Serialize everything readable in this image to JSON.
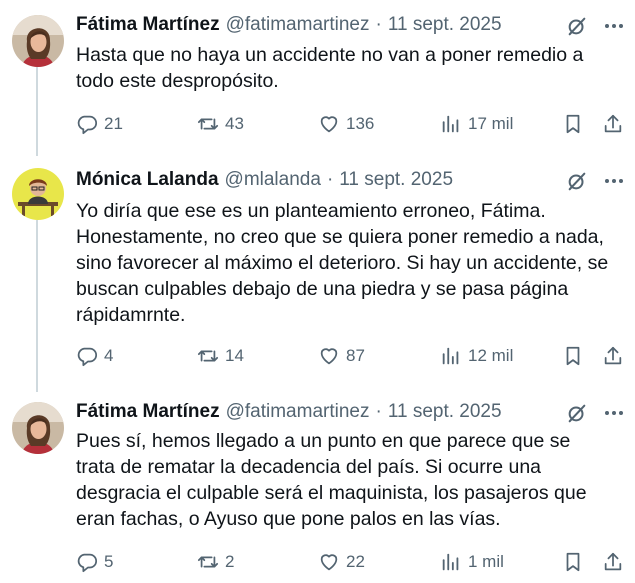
{
  "tweets": [
    {
      "author_name": "Fátima Martínez",
      "handle": "@fatimamartinez",
      "separator": "·",
      "date": "11 sept. 2025",
      "lines": [
        "Hasta que no haya un accidente no van a poner remedio a",
        "todo este despropósito."
      ],
      "replies": "21",
      "retweets": "43",
      "likes": "136",
      "views": "17 mil"
    },
    {
      "author_name": "Mónica Lalanda",
      "handle": "@mlalanda",
      "separator": "·",
      "date": "11 sept. 2025",
      "lines": [
        "Yo diría que ese es un planteamiento erroneo, Fátima.",
        "Honestamente, no creo que se quiera poner remedio a nada,",
        "sino favorecer al máximo el deterioro. Si hay un accidente, se",
        "buscan culpables debajo de una piedra y se pasa página",
        "rápidamrnte."
      ],
      "replies": "4",
      "retweets": "14",
      "likes": "87",
      "views": "12 mil"
    },
    {
      "author_name": "Fátima Martínez",
      "handle": "@fatimamartinez",
      "separator": "·",
      "date": "11 sept. 2025",
      "lines": [
        "Pues sí, hemos llegado a un punto en que parece que se",
        "trata de rematar la decadencia del país. Si ocurre una",
        "desgracia el culpable será el maquinista, los pasajeros que",
        "eran fachas, o Ayuso que pone palos en las vías."
      ],
      "replies": "5",
      "retweets": "2",
      "likes": "22",
      "views": "1 mil"
    }
  ],
  "icons": {
    "reply": "reply-icon",
    "retweet": "retweet-icon",
    "like": "like-icon",
    "views": "views-icon",
    "bookmark": "bookmark-icon",
    "share": "share-icon",
    "grok": "grok-icon",
    "more": "more-icon"
  },
  "colors": {
    "text": "#0f1419",
    "secondary": "#536471",
    "thread_line": "#cfd9de"
  }
}
